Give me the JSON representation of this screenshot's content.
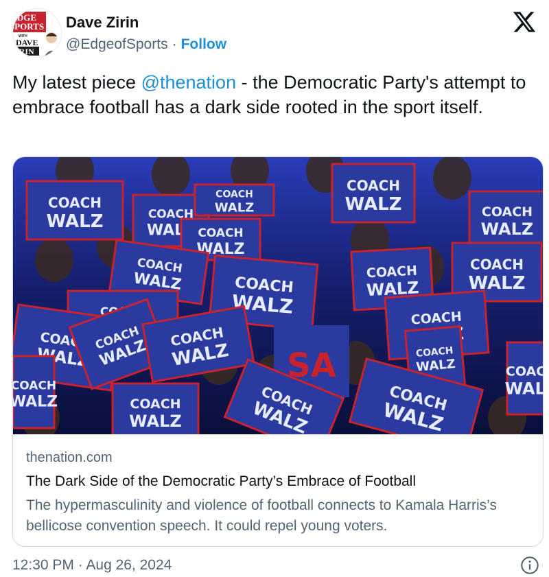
{
  "author": {
    "display_name": "Dave Zirin",
    "handle": "@EdgeofSports",
    "separator": "·",
    "follow_label": "Follow",
    "avatar_logo": {
      "line1": "DGE",
      "line2": "SPORTS",
      "line3": "WITH",
      "line4": "DAVE",
      "line5": "IRIN"
    }
  },
  "tweet": {
    "text_before": "My latest piece ",
    "mention": "@thenation",
    "text_after": " - the Democratic Party's attempt to embrace football has a dark side rooted in the sport itself."
  },
  "card": {
    "image_description_icon": "crowd-with-signs-photo",
    "signs": {
      "coach": "COACH",
      "walz": "WALZ",
      "usa": "SA"
    },
    "domain": "thenation.com",
    "title": "The Dark Side of the Democratic Party’s Embrace of Football",
    "description": "The hypermasculinity and violence of football connects to Kamala Harris’s bellicose convention speech. It could repel young voters."
  },
  "footer": {
    "timestamp": "12:30 PM · Aug 26, 2024"
  },
  "colors": {
    "link": "#1d8fd6",
    "text": "#0f1419",
    "muted": "#536471",
    "border": "#cfd9de",
    "sign_blue": "#2b3a9e",
    "sign_red": "#c8222e"
  },
  "icons": {
    "x_logo": "x-logo-icon",
    "info": "info-icon"
  }
}
